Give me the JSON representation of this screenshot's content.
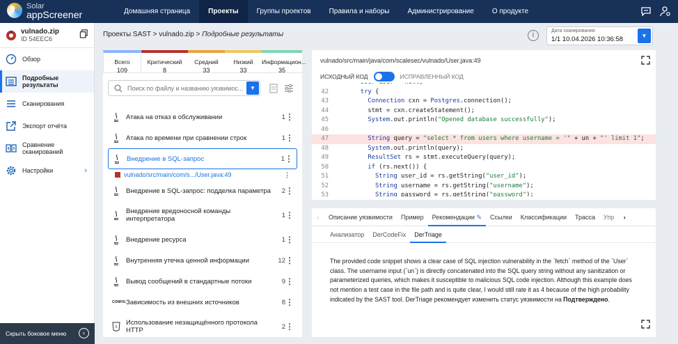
{
  "app": {
    "logo_line1": "Solar",
    "logo_line2": "appScreener"
  },
  "nav": {
    "items": [
      "Домашняя страница",
      "Проекты",
      "Группы проектов",
      "Правила и наборы",
      "Администрирование",
      "О продукте"
    ],
    "active": 1
  },
  "project": {
    "name": "vulnado.zip",
    "id": "ID 54EEC6"
  },
  "sidebar": {
    "items": [
      {
        "label": "Обзор",
        "icon": "gauge-icon"
      },
      {
        "label": "Подробные результаты",
        "icon": "list-icon"
      },
      {
        "label": "Сканирования",
        "icon": "lines-icon"
      },
      {
        "label": "Экспорт отчёта",
        "icon": "export-icon"
      },
      {
        "label": "Сравнение сканирований",
        "icon": "compare-icon"
      },
      {
        "label": "Настройки",
        "icon": "gear-icon"
      }
    ],
    "hide_label": "Скрыть боковое меню"
  },
  "breadcrumb": {
    "root": "Проекты SAST",
    "sep": ">",
    "project": "vulnado.zip",
    "current": "Подробные результаты"
  },
  "scan_date": {
    "label": "Дата сканирования",
    "value": "1/1 10.04.2026 10:36:58"
  },
  "severity_tabs": [
    {
      "label": "Всего",
      "count": "109",
      "color": "#8ab4ff"
    },
    {
      "label": "Критический",
      "count": "8",
      "color": "#b7312c"
    },
    {
      "label": "Средний",
      "count": "33",
      "color": "#e8a33d"
    },
    {
      "label": "Низкий",
      "count": "33",
      "color": "#f0c75e"
    },
    {
      "label": "Информацион...",
      "count": "35",
      "color": "#7fd6b0"
    }
  ],
  "search": {
    "placeholder": "Поиск по файлу и названию уязвимос..."
  },
  "vulns": [
    {
      "title": "Атака на отказ в обслуживании",
      "count": "1"
    },
    {
      "title": "Атака по времени при сравнении строк",
      "count": "1"
    },
    {
      "title": "Внедрение в SQL-запрос",
      "count": "1"
    },
    {
      "title": "Внедрение в SQL-запрос: подделка параметра",
      "count": "2"
    },
    {
      "title": "Внедрение вредоносной команды интерпретатора",
      "count": "1"
    },
    {
      "title": "Внедрение ресурса",
      "count": "1"
    },
    {
      "title": "Внутренняя утечка ценной информации",
      "count": "12"
    },
    {
      "title": "Вывод сообщений в стандартные потоки",
      "count": "9"
    },
    {
      "title": "Зависимость из внешних источников",
      "count": "8"
    },
    {
      "title": "Использование незащищённого протокола HTTP",
      "count": "2"
    }
  ],
  "selected_sub": {
    "path": "vulnado/src/main/com/s.../User.java:49"
  },
  "code": {
    "file": "vulnado/src/main/java/com/scalesec/vulnado/User.java:49",
    "toggle_left": "ИСХОДНЫЙ КОД",
    "toggle_right": "ИСПРАВЛЕННЫЙ КОД",
    "lines": [
      {
        "n": "",
        "t": "      User user = null;"
      },
      {
        "n": "42",
        "t": "      try {"
      },
      {
        "n": "43",
        "t": "        Connection cxn = Postgres.connection();"
      },
      {
        "n": "44",
        "t": "        stmt = cxn.createStatement();"
      },
      {
        "n": "45",
        "t": "        System.out.println(\"Opened database successfully\");"
      },
      {
        "n": "46",
        "t": ""
      },
      {
        "n": "47",
        "t": "        String query = \"select * from users where username = '\" + un + \"' limit 1\";"
      },
      {
        "n": "48",
        "t": "        System.out.println(query);"
      },
      {
        "n": "49",
        "t": "        ResultSet rs = stmt.executeQuery(query);"
      },
      {
        "n": "50",
        "t": "        if (rs.next()) {"
      },
      {
        "n": "51",
        "t": "          String user_id = rs.getString(\"user_id\");"
      },
      {
        "n": "52",
        "t": "          String username = rs.getString(\"username\");"
      },
      {
        "n": "53",
        "t": "          String password = rs.getString(\"password\");"
      }
    ],
    "highlight": "47"
  },
  "detail_tabs": [
    "Описание уязвимости",
    "Пример",
    "Рекомендации",
    "Ссылки",
    "Классификации",
    "Трасса",
    "Упр"
  ],
  "sub_tabs": [
    "Анализатор",
    "DerCodeFix",
    "DerTriage"
  ],
  "recommendation": {
    "text": "The provided code snippet shows a clear case of SQL injection vulnerability in the `fetch` method of the `User` class. The username input (`un`) is directly concatenated into the SQL query string without any sanitization or parameterized queries, which makes it susceptible to malicious SQL code injection. Although this example does not mention a test case in the file path and is quite clear, I would still rate it as 4 because of the high probability indicated by the SAST tool. DerTriage рекомендует изменить статус уязвимости на ",
    "status": "Подтверждено",
    "end": "."
  }
}
